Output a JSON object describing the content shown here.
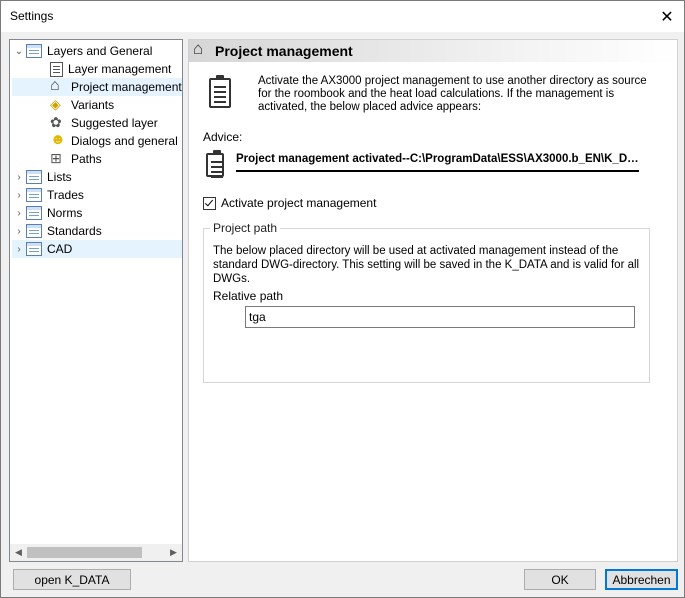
{
  "window": {
    "title": "Settings"
  },
  "tree": {
    "items": [
      {
        "label": "Layers and General",
        "arrow": "⌄",
        "icon": "list-icon"
      },
      {
        "label": "Layer management",
        "icon": "document-icon"
      },
      {
        "label": "Project management",
        "icon": "house-icon",
        "selected": true
      },
      {
        "label": "Variants",
        "icon": "variants-icon"
      },
      {
        "label": "Suggested layer",
        "icon": "suggested-layer-icon"
      },
      {
        "label": "Dialogs and general",
        "icon": "smiley-icon"
      },
      {
        "label": "Paths",
        "icon": "paths-icon"
      },
      {
        "label": "Lists",
        "arrow": "›",
        "icon": "list-icon"
      },
      {
        "label": "Trades",
        "arrow": "›",
        "icon": "list-icon"
      },
      {
        "label": "Norms",
        "arrow": "›",
        "icon": "list-icon"
      },
      {
        "label": "Standards",
        "arrow": "›",
        "icon": "list-icon"
      },
      {
        "label": "CAD",
        "arrow": "›",
        "icon": "list-icon",
        "highlighted": true
      }
    ]
  },
  "panel": {
    "title": "Project management",
    "description": "Activate the AX3000 project management to use another directory as source for the roombook and the heat load calculations. If the management is  activated, the below placed advice appears:",
    "advice_label": "Advice:",
    "advice_text": "Project management activated--C:\\ProgramData\\ESS\\AX3000.b_EN\\K_DATA...",
    "checkbox_label": "Activate project management",
    "checkbox_checked": true,
    "group": {
      "title": "Project path",
      "description": "The below placed directory will be used at activated management instead of the standard DWG-directory. This setting will be saved in the K_DATA and is valid for all DWGs.",
      "relative_path_label": "Relative path",
      "relative_path_value": "tga"
    }
  },
  "buttons": {
    "open_kdata": "open K_DATA",
    "ok": "OK",
    "cancel": "Abbrechen"
  },
  "colors": {
    "selection": "#e5f3ff",
    "default_button_border": "#0078d7"
  }
}
